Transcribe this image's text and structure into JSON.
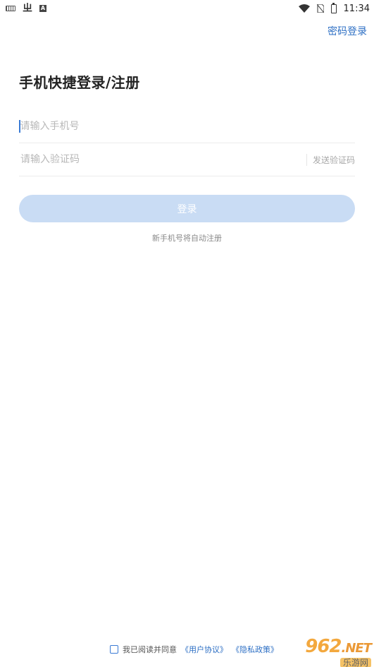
{
  "status_bar": {
    "time": "11:34",
    "left_icons": [
      "keyboard-icon",
      "app-glyph-icon",
      "a-badge-icon"
    ],
    "right_icons": [
      "wifi-icon",
      "no-sim-icon",
      "battery-icon"
    ]
  },
  "header": {
    "password_login_label": "密码登录"
  },
  "title": "手机快捷登录/注册",
  "form": {
    "phone_placeholder": "请输入手机号",
    "code_placeholder": "请输入验证码",
    "send_code_label": "发送验证码",
    "login_label": "登录",
    "hint": "新手机号将自动注册"
  },
  "agreement": {
    "prefix": "我已阅读并同意",
    "user_agreement": "《用户协议》",
    "privacy_policy": "《隐私政策》"
  },
  "watermark": {
    "top": "962",
    "top_suffix": ".NET",
    "bottom": "乐游网"
  },
  "colors": {
    "accent": "#2d6fc4",
    "button_disabled": "#c9dcf4"
  }
}
